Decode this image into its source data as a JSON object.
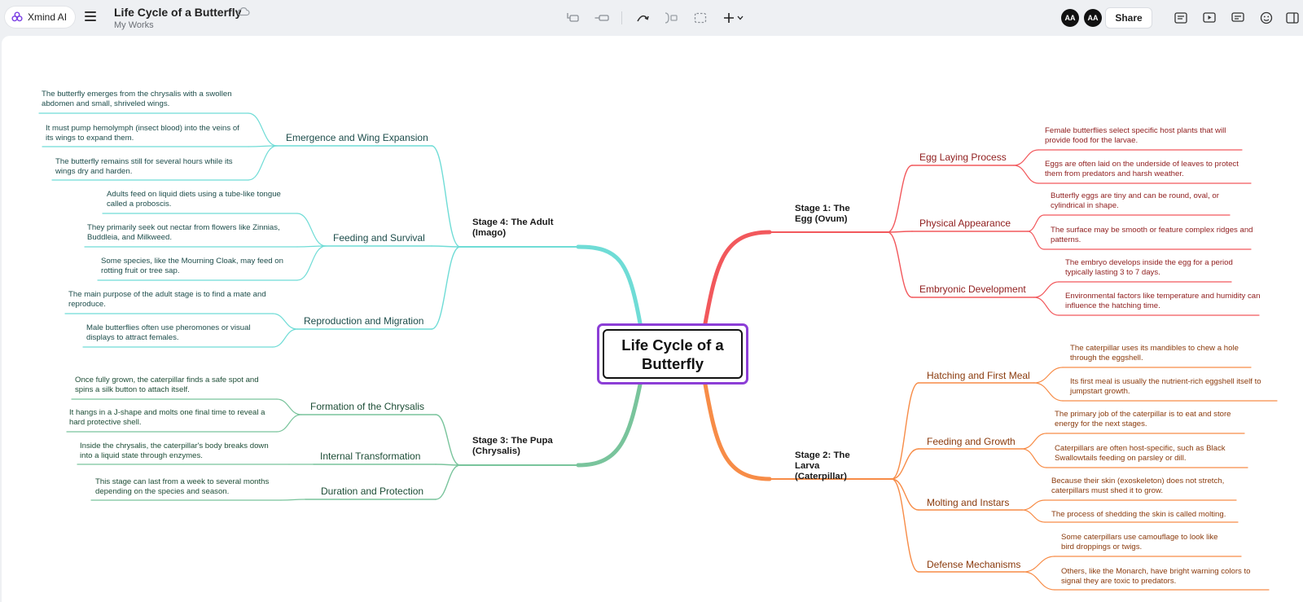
{
  "app": {
    "name": "Xmind AI"
  },
  "document": {
    "title": "Life Cycle of a Butterfly",
    "location": "My Works"
  },
  "toolbar": {
    "tools": [
      {
        "name": "topic-icon",
        "label": ""
      },
      {
        "name": "subtopic-icon",
        "label": ""
      },
      {
        "name": "relationship-icon",
        "label": ""
      },
      {
        "name": "summary-icon",
        "label": ""
      },
      {
        "name": "boundary-icon",
        "label": ""
      },
      {
        "name": "insert-icon",
        "label": ""
      }
    ],
    "collaborators": [
      "AA",
      "AA"
    ],
    "share_label": "Share",
    "right_icons": [
      "outline-icon",
      "present-icon",
      "comment-icon",
      "emoji-icon",
      "panel-icon"
    ]
  },
  "colors": {
    "stage1": "#f2585c",
    "stage2": "#f78c47",
    "stage3": "#79c49c",
    "stage4": "#6fdcd6",
    "root_border": "#8c3ed6"
  },
  "mindmap": {
    "root": "Life Cycle of a Butterfly",
    "stages": [
      {
        "title": "Stage 1: The Egg (Ovum)",
        "branches": [
          {
            "title": "Egg Laying Process",
            "details": [
              "Female butterflies select specific host plants that will provide food for the larvae.",
              "Eggs are often laid on the underside of leaves to protect them from predators and harsh weather."
            ]
          },
          {
            "title": "Physical Appearance",
            "details": [
              "Butterfly eggs are tiny and can be round, oval, or cylindrical in shape.",
              "The surface may be smooth or feature complex ridges and patterns."
            ]
          },
          {
            "title": "Embryonic Development",
            "details": [
              "The embryo develops inside the egg for a period typically lasting 3 to 7 days.",
              "Environmental factors like temperature and humidity can influence the hatching time."
            ]
          }
        ]
      },
      {
        "title": "Stage 2: The Larva (Caterpillar)",
        "branches": [
          {
            "title": "Hatching and First Meal",
            "details": [
              "The caterpillar uses its mandibles to chew a hole through the eggshell.",
              "Its first meal is usually the nutrient-rich eggshell itself to jumpstart growth."
            ]
          },
          {
            "title": "Feeding and Growth",
            "details": [
              "The primary job of the caterpillar is to eat and store energy for the next stages.",
              "Caterpillars are often host-specific, such as Black Swallowtails feeding on parsley or dill."
            ]
          },
          {
            "title": "Molting and Instars",
            "details": [
              "Because their skin (exoskeleton) does not stretch, caterpillars must shed it to grow.",
              "The process of shedding the skin is called molting."
            ]
          },
          {
            "title": "Defense Mechanisms",
            "details": [
              "Some caterpillars use camouflage to look like bird droppings or twigs.",
              "Others, like the Monarch, have bright warning colors to signal they are toxic to predators."
            ]
          }
        ]
      },
      {
        "title": "Stage 3: The Pupa (Chrysalis)",
        "branches": [
          {
            "title": "Formation of the Chrysalis",
            "details": [
              "Once fully grown, the caterpillar finds a safe spot and spins a silk button to attach itself.",
              "It hangs in a J-shape and molts one final time to reveal a hard protective shell."
            ]
          },
          {
            "title": "Internal Transformation",
            "details": [
              "Inside the chrysalis, the caterpillar's body breaks down into a liquid state through enzymes."
            ]
          },
          {
            "title": "Duration and Protection",
            "details": [
              "This stage can last from a week to several months depending on the species and season."
            ]
          }
        ]
      },
      {
        "title": "Stage 4: The Adult (Imago)",
        "branches": [
          {
            "title": "Emergence and Wing Expansion",
            "details": [
              "The butterfly emerges from the chrysalis with a swollen abdomen and small, shriveled wings.",
              "It must pump hemolymph (insect blood) into the veins of its wings to expand them.",
              "The butterfly remains still for several hours while its wings dry and harden."
            ]
          },
          {
            "title": "Feeding and Survival",
            "details": [
              "Adults feed on liquid diets using a tube-like tongue called a proboscis.",
              "They primarily seek out nectar from flowers like Zinnias, Buddleia, and Milkweed.",
              "Some species, like the Mourning Cloak, may feed on rotting fruit or tree sap."
            ]
          },
          {
            "title": "Reproduction and Migration",
            "details": [
              "The main purpose of the adult stage is to find a mate and reproduce.",
              "Male butterflies often use pheromones or visual displays to attract females."
            ]
          }
        ]
      }
    ]
  }
}
